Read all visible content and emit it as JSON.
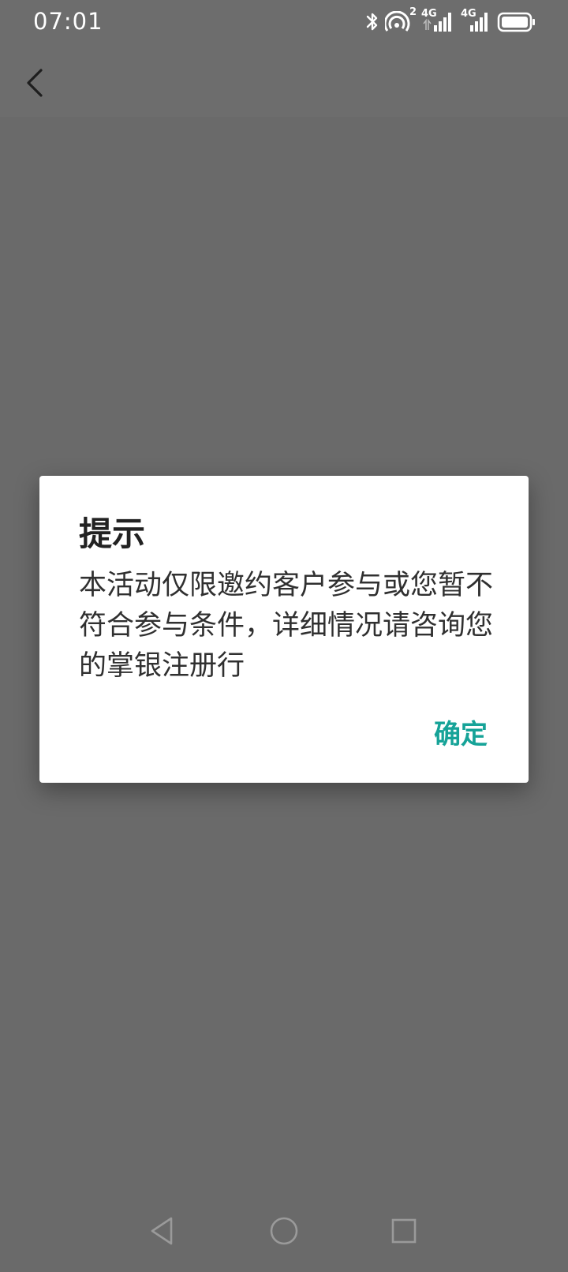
{
  "status_bar": {
    "time": "07:01",
    "sim1_network": "4G",
    "sim2_network": "4G",
    "hotspot_badge": "2",
    "icons": [
      "bluetooth-icon",
      "hotspot-icon",
      "signal-icon",
      "signal-icon",
      "battery-icon"
    ]
  },
  "header": {
    "back_icon": "chevron-left-icon"
  },
  "dialog": {
    "title": "提示",
    "message": "本活动仅限邀约客户参与或您暂不符合参与条件，详细情况请咨询您的掌银注册行",
    "confirm_label": "确定",
    "accent_color": "#16a398"
  },
  "nav_bar": {
    "icons": [
      "back-triangle-icon",
      "home-circle-icon",
      "recents-square-icon"
    ]
  }
}
